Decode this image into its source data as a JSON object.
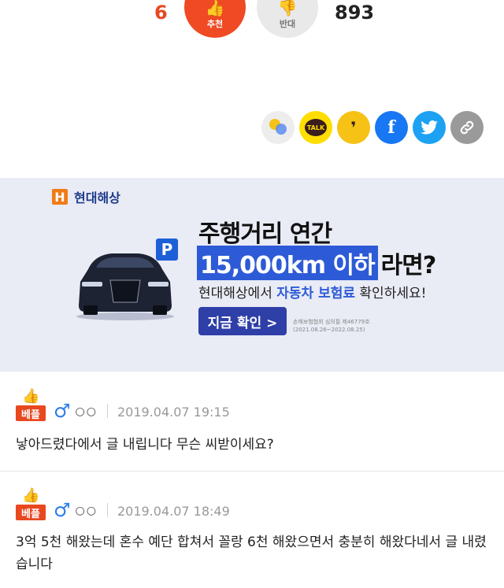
{
  "vote": {
    "up_count": "6",
    "up_label": "추천",
    "down_label": "반대",
    "down_count": "893"
  },
  "share": {
    "icons": [
      "kakaostory-icon",
      "kakaotalk-icon",
      "band-icon",
      "facebook-icon",
      "twitter-icon",
      "link-icon"
    ],
    "kakaotalk_text": "TALK"
  },
  "ad": {
    "brand": "현대해상",
    "headline1": "주행거리 연간",
    "headline2_highlight": "15,000km 이하",
    "headline2_rest": "라면?",
    "sub_pre": "현대해상에서 ",
    "sub_accent": "자동차 보험료",
    "sub_post": " 확인하세요!",
    "cta": "지금 확인 >",
    "legal_line1": "손해보험협회 심의필 제46779호",
    "legal_line2": "(2021.08.26~2022.08.25)"
  },
  "comments": [
    {
      "badge": "베플",
      "nickname": "○○",
      "date": "2019.04.07 19:15",
      "text": "낳아드렸다에서 글 내립니다 무슨 씨받이세요?"
    },
    {
      "badge": "베플",
      "nickname": "○○",
      "date": "2019.04.07 18:49",
      "text": "3억 5천 해왔는데 혼수 예단 합쳐서 꼴랑 6천 해왔으면서 충분히 해왔다네서 글 내렸습니다"
    }
  ],
  "colors": {
    "accent": "#ef4a23",
    "ad_bg": "#e9ebf5",
    "ad_blue": "#2d5bd7",
    "male": "#2b7de9"
  }
}
